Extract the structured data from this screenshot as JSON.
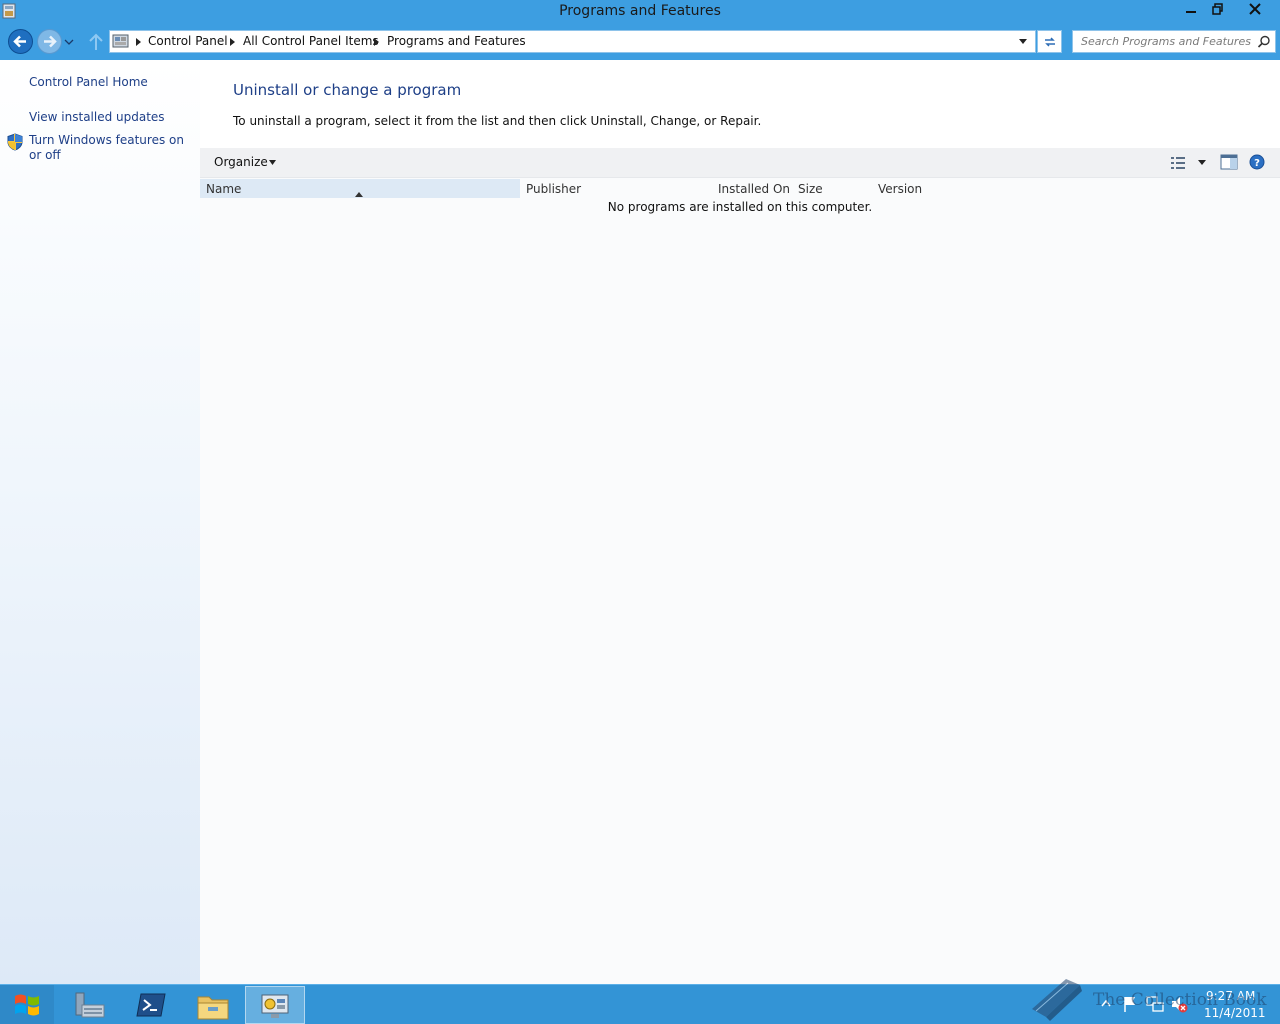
{
  "window": {
    "title": "Programs and Features"
  },
  "navigation": {
    "breadcrumbs": [
      "Control Panel",
      "All Control Panel Items",
      "Programs and Features"
    ],
    "search_placeholder": "Search Programs and Features"
  },
  "left_pane": {
    "home_link": "Control Panel Home",
    "links": [
      "View installed updates",
      "Turn Windows features on or off"
    ]
  },
  "main": {
    "title": "Uninstall or change a program",
    "description": "To uninstall a program, select it from the list and then click Uninstall, Change, or Repair.",
    "toolbar": {
      "organize_label": "Organize"
    },
    "columns": [
      "Name",
      "Publisher",
      "Installed On",
      "Size",
      "Version"
    ],
    "sorted_column": "Name",
    "empty_message": "No programs are installed on this computer."
  },
  "taskbar": {
    "clock_time": "9:27 AM",
    "clock_date": "11/4/2011"
  },
  "watermark": {
    "text": "The Collection Book"
  },
  "colors": {
    "titlebar": "#3d9ee1",
    "link": "#1e3f87",
    "taskbar": "#3394d6"
  },
  "icons": [
    "app-icon",
    "minimize-icon",
    "maximize-icon",
    "close-icon",
    "back-arrow-icon",
    "forward-arrow-icon",
    "recent-pages-icon",
    "up-arrow-icon",
    "control-panel-icon",
    "dropdown-arrow-icon",
    "refresh-icon",
    "search-icon",
    "shield-icon",
    "view-options-icon",
    "preview-pane-icon",
    "help-icon",
    "windows-logo-icon",
    "server-manager-icon",
    "powershell-icon",
    "file-explorer-icon",
    "control-panel-taskbar-icon",
    "flag-icon",
    "network-icon",
    "volume-icon",
    "book-icon"
  ]
}
